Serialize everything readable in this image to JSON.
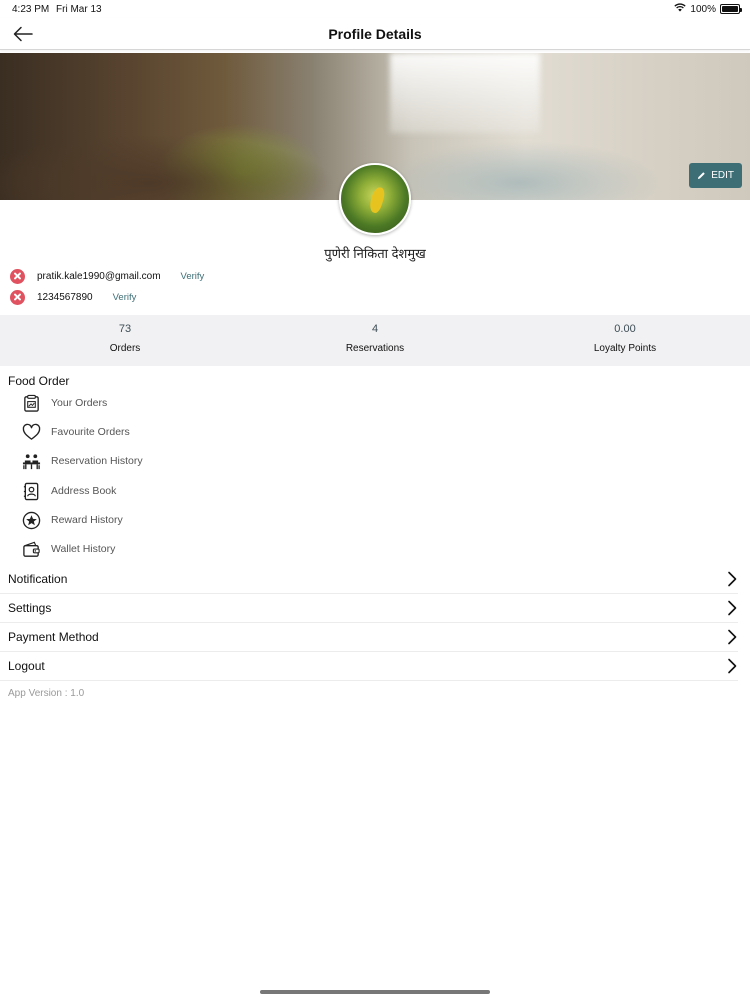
{
  "status_bar": {
    "time": "4:23 PM",
    "date": "Fri Mar 13",
    "battery": "100%",
    "battery_level": 1.0
  },
  "header": {
    "title": "Profile Details"
  },
  "cover": {
    "edit_label": "EDIT"
  },
  "profile": {
    "name": "पुणेरी निकिता देशमुख",
    "email": "pratik.kale1990@gmail.com",
    "phone": "1234567890",
    "verify_label": "Verify"
  },
  "stats": [
    {
      "value": "73",
      "label": "Orders"
    },
    {
      "value": "4",
      "label": "Reservations"
    },
    {
      "value": "0.00",
      "label": "Loyalty Points"
    }
  ],
  "food_order": {
    "title": "Food Order",
    "items": [
      {
        "label": "Your Orders",
        "icon": "orders-icon"
      },
      {
        "label": "Favourite Orders",
        "icon": "heart-icon"
      },
      {
        "label": "Reservation History",
        "icon": "dining-table-icon"
      },
      {
        "label": "Address Book",
        "icon": "address-book-icon"
      },
      {
        "label": "Reward History",
        "icon": "star-icon"
      },
      {
        "label": "Wallet History",
        "icon": "wallet-icon"
      }
    ]
  },
  "nav_items": [
    {
      "label": "Notification"
    },
    {
      "label": "Settings"
    },
    {
      "label": "Payment Method"
    },
    {
      "label": "Logout"
    }
  ],
  "app_version": "App Version : 1.0",
  "colors": {
    "accent": "#3d6e76",
    "error": "#e0525f",
    "stats_bg": "#f1f1f3"
  }
}
